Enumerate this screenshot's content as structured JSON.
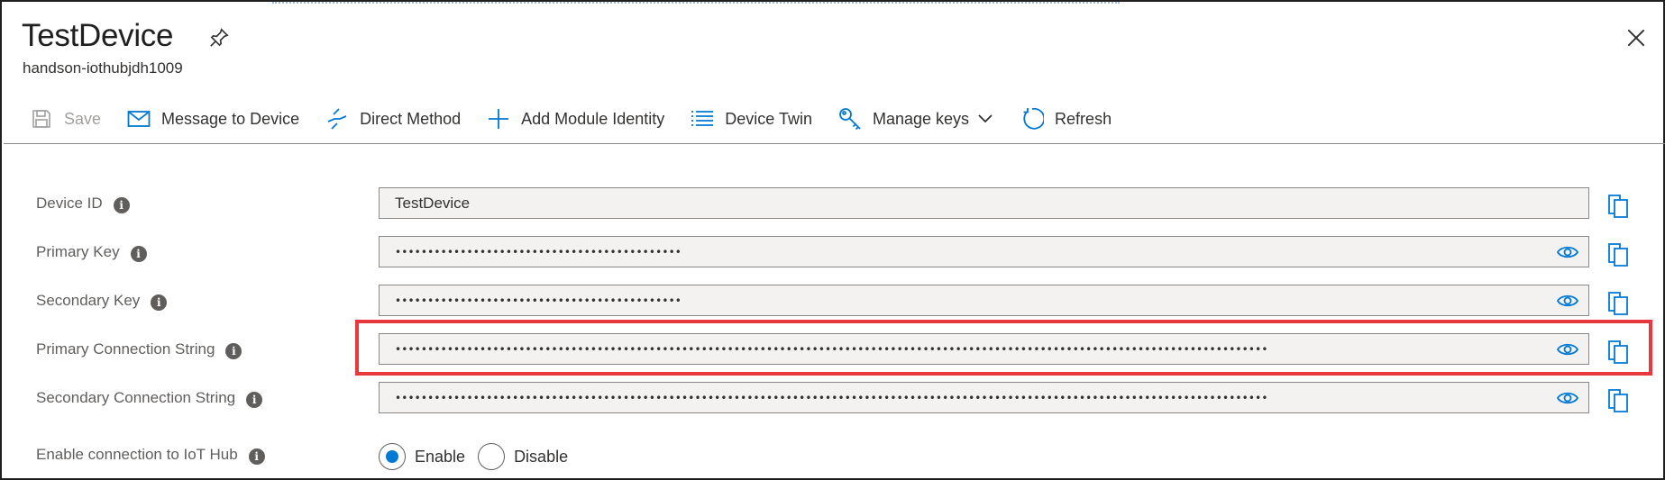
{
  "header": {
    "title": "TestDevice",
    "subtitle": "handson-iothubjdh1009"
  },
  "toolbar": {
    "items": [
      {
        "label": "Save",
        "icon": "save-icon",
        "enabled": false
      },
      {
        "label": "Message to Device",
        "icon": "mail-icon",
        "enabled": true
      },
      {
        "label": "Direct Method",
        "icon": "direct-method-icon",
        "enabled": true
      },
      {
        "label": "Add Module Identity",
        "icon": "plus-icon",
        "enabled": true
      },
      {
        "label": "Device Twin",
        "icon": "list-icon",
        "enabled": true
      },
      {
        "label": "Manage keys",
        "icon": "key-icon",
        "enabled": true,
        "has_dropdown": true
      },
      {
        "label": "Refresh",
        "icon": "refresh-icon",
        "enabled": true
      }
    ]
  },
  "fields": [
    {
      "label": "Device ID",
      "value": "TestDevice",
      "masked": false
    },
    {
      "label": "Primary Key",
      "value": "••••••••••••••••••••••••••••••••••••••••••••",
      "masked": true
    },
    {
      "label": "Secondary Key",
      "value": "••••••••••••••••••••••••••••••••••••••••••••",
      "masked": true
    },
    {
      "label": "Primary Connection String",
      "value": "••••••••••••••••••••••••••••••••••••••••••••••••••••••••••••••••••••••••••••••••••••••••••••••••••••••••••••••••••••••••••••••••••••••",
      "masked": true,
      "highlighted": true
    },
    {
      "label": "Secondary Connection String",
      "value": "••••••••••••••••••••••••••••••••••••••••••••••••••••••••••••••••••••••••••••••••••••••••••••••••••••••••••••••••••••••••••••••••••••••",
      "masked": true
    }
  ],
  "connection": {
    "label": "Enable connection to IoT Hub",
    "options": [
      "Enable",
      "Disable"
    ],
    "selected": "Enable"
  },
  "colors": {
    "accent": "#0078d4",
    "highlight": "#e8383d"
  }
}
